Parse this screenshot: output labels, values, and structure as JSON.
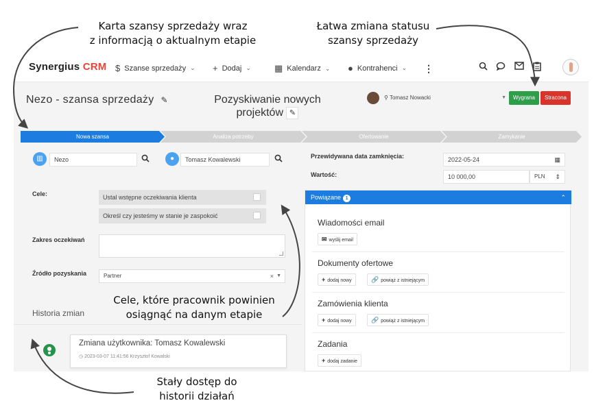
{
  "annotations": {
    "top_left": [
      "Karta szansy sprzedaży wraz",
      "z informacją o aktualnym etapie"
    ],
    "top_right": [
      "Łatwa zmiana statusu",
      "szansy sprzedaży"
    ],
    "middle": [
      "Cele, które pracownik powinien",
      "osiągnąć na danym etapie"
    ],
    "bottom": [
      "Stały dostęp do",
      "historii działań"
    ]
  },
  "topnav": {
    "logo_main": "Synergius ",
    "logo_accent": "CRM",
    "items": [
      {
        "icon": "$",
        "label": "Szanse sprzedaży"
      },
      {
        "icon": "+",
        "label": "Dodaj"
      },
      {
        "icon": "▦",
        "label": "Kalendarz"
      },
      {
        "icon": "●",
        "label": "Kontrahenci"
      }
    ],
    "more": "⋮"
  },
  "opportunity": {
    "title": "Nezo - szansa sprzedaży",
    "stage_title_line1": "Pozyskiwanie nowych",
    "stage_title_line2": "projektów",
    "owner": "Tomasz Nowacki",
    "win_label": "Wygrana",
    "lose_label": "Stracona"
  },
  "stages": [
    "Nowa szansa",
    "Analiza potrzeby",
    "Ofertowanie",
    "Zamykanie"
  ],
  "left": {
    "client": "Nezo",
    "contact": "Tomasz Kowalewski",
    "goals_label": "Cele:",
    "goals": [
      "Ustal wstępne oczekiwania klienta",
      "Określ czy jesteśmy w stanie je zaspokoić"
    ],
    "scope_label": "Zakres oczekiwań",
    "source_label": "Źródło pozyskania",
    "source_value": "Partner",
    "source_clear": "×",
    "history_title": "Historia zmian",
    "history_entry": "Zmiana użytkownika: Tomasz Kowalewski",
    "history_meta": "2023-03-07 11:41:56 Krzysztof Kowalski"
  },
  "right": {
    "close_date_label": "Przewidywana data zamknięcia:",
    "close_date": "2022-05-24",
    "value_label": "Wartość:",
    "value": "10 000,00",
    "currency": "PLN",
    "related_label": "Powiązane",
    "related_count": "1",
    "sections": [
      {
        "title": "Wiadomości email",
        "buttons": [
          {
            "icon": "✉",
            "label": "wyślij email"
          }
        ]
      },
      {
        "title": "Dokumenty ofertowe",
        "buttons": [
          {
            "icon": "+",
            "label": "dodaj nowy"
          },
          {
            "icon": "🔗",
            "label": "powiąż z istniejącym"
          }
        ]
      },
      {
        "title": "Zamówienia klienta",
        "buttons": [
          {
            "icon": "+",
            "label": "dodaj nowy"
          },
          {
            "icon": "🔗",
            "label": "powiąż z istniejącym"
          }
        ]
      },
      {
        "title": "Zadania",
        "buttons": [
          {
            "icon": "+",
            "label": "dodaj zadanie"
          }
        ]
      }
    ]
  },
  "colors": {
    "accent_blue": "#1c7ce0",
    "win_green": "#2e9e4a",
    "lose_red": "#d9342b",
    "brand_red": "#e8443a"
  }
}
